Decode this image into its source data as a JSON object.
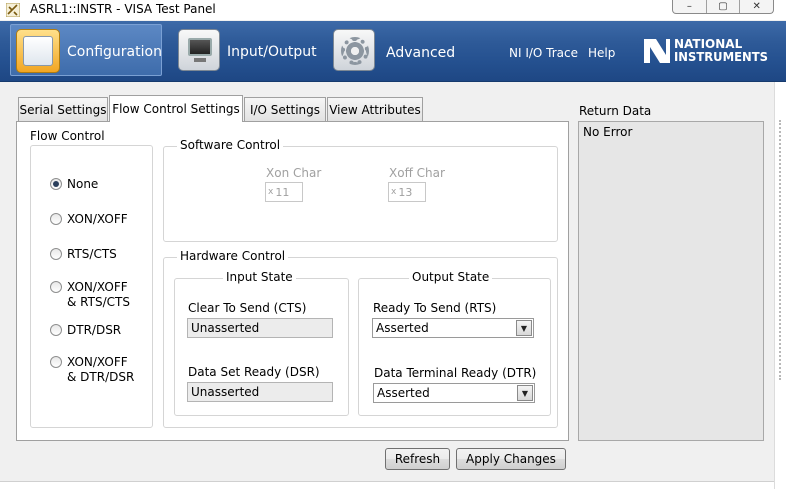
{
  "window": {
    "title": "ASRL1::INSTR - VISA Test Panel",
    "controls": [
      "–",
      "▢",
      "✕"
    ]
  },
  "nav": {
    "configuration": "Configuration",
    "input_output": "Input/Output",
    "advanced": "Advanced",
    "ni_io_trace": "NI I/O Trace",
    "help": "Help",
    "logo_line1": "NATIONAL",
    "logo_line2": "INSTRUMENTS"
  },
  "tabs": [
    {
      "label": "Serial Settings",
      "active": false
    },
    {
      "label": "Flow Control Settings",
      "active": true
    },
    {
      "label": "I/O Settings",
      "active": false
    },
    {
      "label": "View Attributes",
      "active": false
    }
  ],
  "flow_control": {
    "title": "Flow Control",
    "options": [
      {
        "line1": "None",
        "line2": "",
        "selected": true
      },
      {
        "line1": "XON/XOFF",
        "line2": "",
        "selected": false
      },
      {
        "line1": "RTS/CTS",
        "line2": "",
        "selected": false
      },
      {
        "line1": "XON/XOFF",
        "line2": "& RTS/CTS",
        "selected": false
      },
      {
        "line1": "DTR/DSR",
        "line2": "",
        "selected": false
      },
      {
        "line1": "XON/XOFF",
        "line2": "& DTR/DSR",
        "selected": false
      }
    ]
  },
  "software_control": {
    "title": "Software Control",
    "xon_label": "Xon Char",
    "xon_prefix": "x",
    "xon_value": "11",
    "xoff_label": "Xoff Char",
    "xoff_prefix": "x",
    "xoff_value": "13"
  },
  "hardware_control": {
    "title": "Hardware Control",
    "input_state": {
      "title": "Input State",
      "cts_label": "Clear To Send (CTS)",
      "cts_value": "Unasserted",
      "dsr_label": "Data Set Ready (DSR)",
      "dsr_value": "Unasserted"
    },
    "output_state": {
      "title": "Output State",
      "rts_label": "Ready To Send (RTS)",
      "rts_value": "Asserted",
      "dtr_label": "Data Terminal Ready (DTR)",
      "dtr_value": "Asserted"
    }
  },
  "return_data": {
    "title": "Return Data",
    "value": "No Error"
  },
  "buttons": {
    "refresh": "Refresh",
    "apply": "Apply Changes"
  },
  "colors": {
    "nav_blue": "#2e5a98",
    "config_icon": "#f2a623"
  }
}
